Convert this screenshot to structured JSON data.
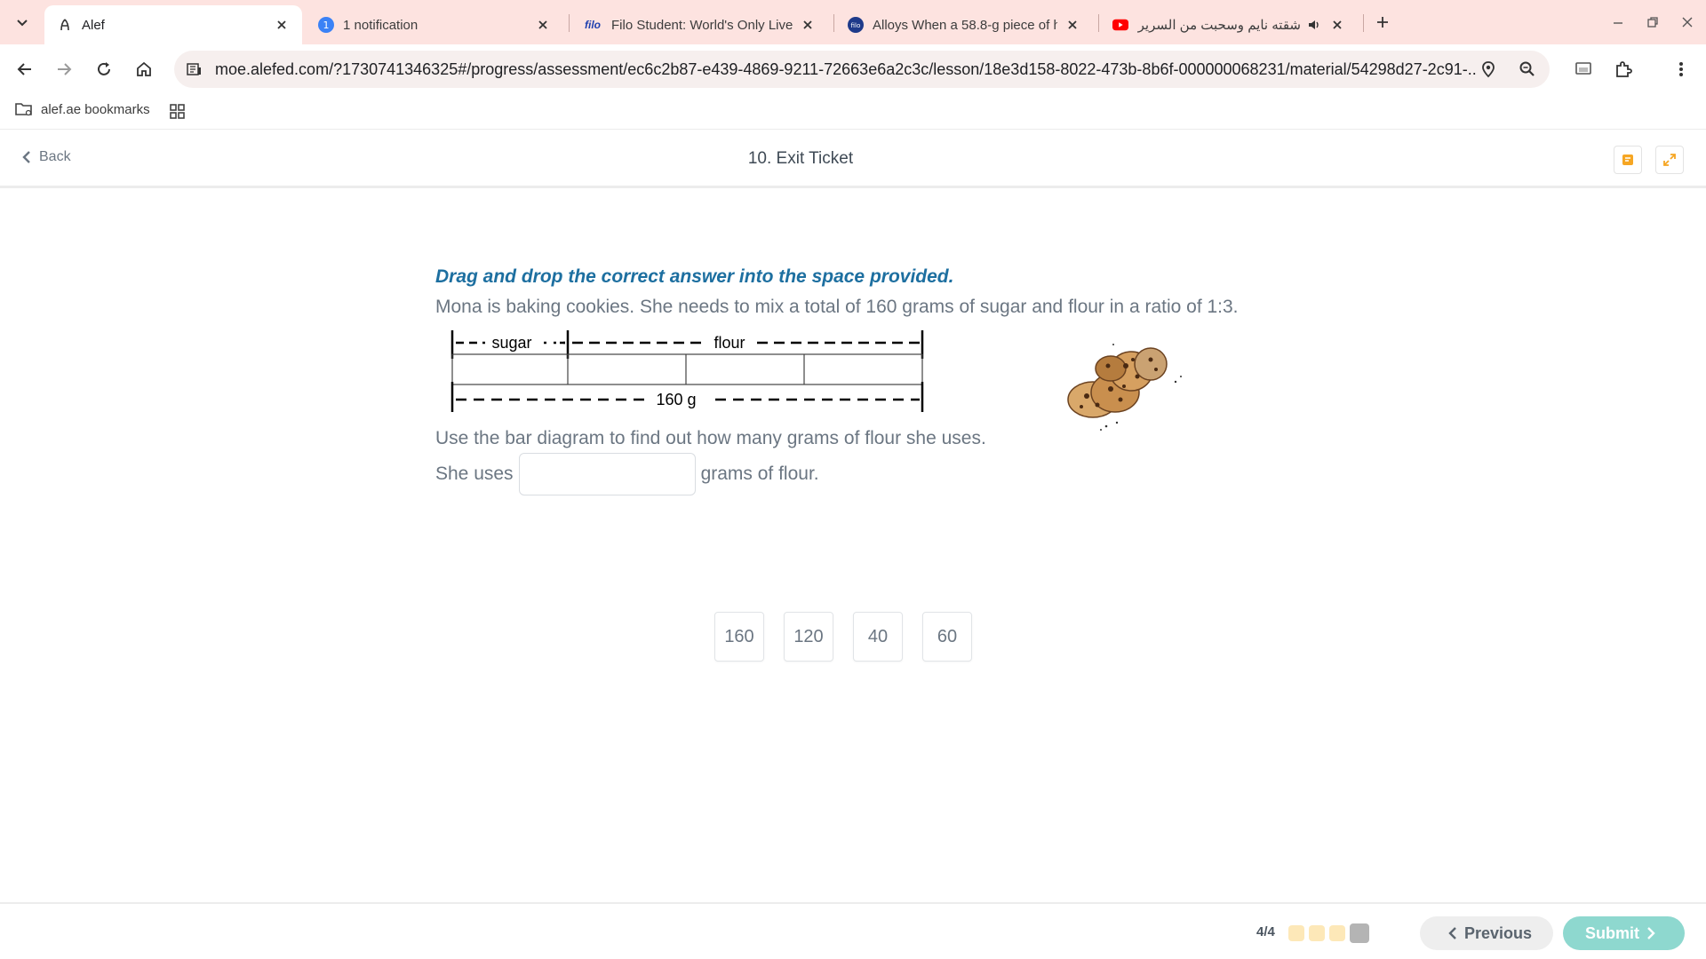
{
  "browser": {
    "tabs": [
      {
        "title": "Alef",
        "active": true
      },
      {
        "title": "1 notification",
        "badge": "1",
        "active": false
      },
      {
        "title": "Filo Student: World's Only Live I",
        "fav_text": "filo",
        "active": false
      },
      {
        "title": "Alloys When a 58.8-g piece of h",
        "fav_text": "filo",
        "active": false
      },
      {
        "title": "شقته نايم وسحبت من السرير",
        "active": false
      }
    ],
    "url": "moe.alefed.com/?1730741346325#/progress/assessment/ec6c2b87-e439-4869-9211-72663e6a2c3c/lesson/18e3d158-8022-473b-8b6f-000000068231/material/54298d27-2c91-...",
    "bookmark": "alef.ae bookmarks",
    "colors": {
      "tabstrip": "#fde3e0",
      "accent_blue": "#1d6fa0",
      "submit": "#8ed8cf"
    }
  },
  "header": {
    "back_label": "Back",
    "title": "10. Exit Ticket"
  },
  "question": {
    "instruction": "Drag and drop the correct answer into the space provided.",
    "text": "Mona is baking cookies. She needs to mix a total of 160 grams of sugar and flour in a ratio of 1:3.",
    "diagram": {
      "label_sugar": "sugar",
      "label_flour": "flour",
      "label_total": "160 g",
      "segments": 4
    },
    "prompt": "Use the bar diagram to find out how many grams of flour she uses.",
    "answer_prefix": "She uses",
    "answer_suffix": "grams of flour.",
    "choices": [
      "160",
      "120",
      "40",
      "60"
    ]
  },
  "footer": {
    "progress": "4/4",
    "previous_label": "Previous",
    "submit_label": "Submit"
  }
}
